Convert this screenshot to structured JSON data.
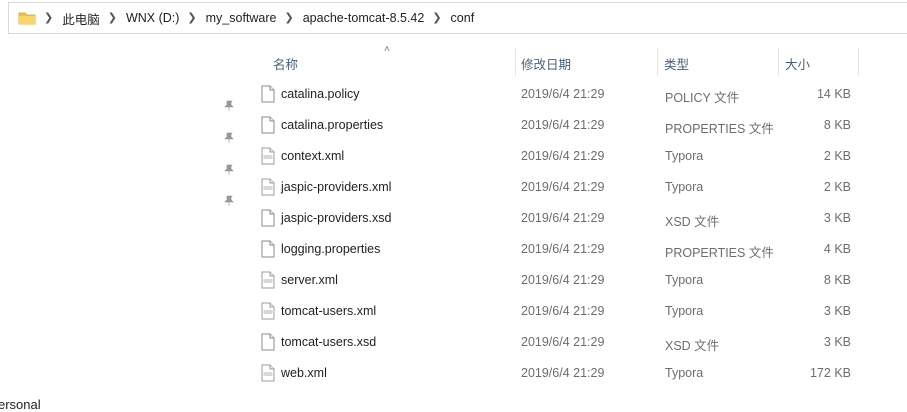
{
  "breadcrumb": {
    "items": [
      "此电脑",
      "WNX (D:)",
      "my_software",
      "apache-tomcat-8.5.42",
      "conf"
    ]
  },
  "nav": {
    "partial_label": "ersonal"
  },
  "columns": {
    "name": "名称",
    "date": "修改日期",
    "type": "类型",
    "size": "大小"
  },
  "files": [
    {
      "name": "catalina.policy",
      "date": "2019/6/4 21:29",
      "type": "POLICY 文件",
      "size": "14 KB",
      "icon": "generic-file-icon"
    },
    {
      "name": "catalina.properties",
      "date": "2019/6/4 21:29",
      "type": "PROPERTIES 文件",
      "size": "8 KB",
      "icon": "generic-file-icon"
    },
    {
      "name": "context.xml",
      "date": "2019/6/4 21:29",
      "type": "Typora",
      "size": "2 KB",
      "icon": "typora-file-icon"
    },
    {
      "name": "jaspic-providers.xml",
      "date": "2019/6/4 21:29",
      "type": "Typora",
      "size": "2 KB",
      "icon": "typora-file-icon"
    },
    {
      "name": "jaspic-providers.xsd",
      "date": "2019/6/4 21:29",
      "type": "XSD 文件",
      "size": "3 KB",
      "icon": "generic-file-icon"
    },
    {
      "name": "logging.properties",
      "date": "2019/6/4 21:29",
      "type": "PROPERTIES 文件",
      "size": "4 KB",
      "icon": "generic-file-icon"
    },
    {
      "name": "server.xml",
      "date": "2019/6/4 21:29",
      "type": "Typora",
      "size": "8 KB",
      "icon": "typora-file-icon"
    },
    {
      "name": "tomcat-users.xml",
      "date": "2019/6/4 21:29",
      "type": "Typora",
      "size": "3 KB",
      "icon": "typora-file-icon"
    },
    {
      "name": "tomcat-users.xsd",
      "date": "2019/6/4 21:29",
      "type": "XSD 文件",
      "size": "3 KB",
      "icon": "generic-file-icon"
    },
    {
      "name": "web.xml",
      "date": "2019/6/4 21:29",
      "type": "Typora",
      "size": "172 KB",
      "icon": "typora-file-icon"
    }
  ],
  "colors": {
    "folder": "#f0c24b",
    "header_text": "#4c607a"
  }
}
